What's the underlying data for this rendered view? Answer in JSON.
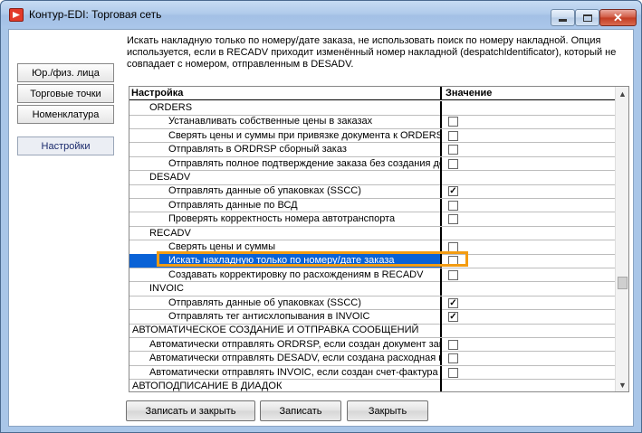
{
  "window": {
    "title": "Контур-EDI: Торговая сеть",
    "close_glyph": "✕"
  },
  "description": "Искать накладную только по номеру/дате заказа, не использовать поиск по номеру накладной. Опция используется, если в RECADV приходит изменённый номер накладной (despatchIdentificator), который не совпадает с номером, отправленным в DESADV.",
  "sidebar": {
    "items": [
      {
        "label": "Юр./физ. лица"
      },
      {
        "label": "Торговые точки"
      },
      {
        "label": "Номенклатура"
      },
      {
        "label": "Настройки"
      }
    ]
  },
  "grid": {
    "headers": {
      "setting": "Настройка",
      "value": "Значение"
    },
    "rows": [
      {
        "label": "ORDERS",
        "level": "lvl1",
        "checkbox": false
      },
      {
        "label": "Устанавливать собственные цены в заказах",
        "level": "lvl2",
        "checkbox": true,
        "checked": false
      },
      {
        "label": "Сверять цены и суммы при привязке документа к ORDERS",
        "level": "lvl2",
        "checkbox": true,
        "checked": false
      },
      {
        "label": "Отправлять в ORDRSP сборный заказ",
        "level": "lvl2",
        "checkbox": true,
        "checked": false
      },
      {
        "label": "Отправлять полное подтверждение заказа без создания документа",
        "level": "lvl2",
        "checkbox": true,
        "checked": false
      },
      {
        "label": "DESADV",
        "level": "lvl1",
        "checkbox": false
      },
      {
        "label": "Отправлять данные об упаковках (SSCC)",
        "level": "lvl2",
        "checkbox": true,
        "checked": true
      },
      {
        "label": "Отправлять данные по ВСД",
        "level": "lvl2",
        "checkbox": true,
        "checked": false
      },
      {
        "label": "Проверять корректность номера автотранспорта",
        "level": "lvl2",
        "checkbox": true,
        "checked": false
      },
      {
        "label": "RECADV",
        "level": "lvl1",
        "checkbox": false
      },
      {
        "label": "Сверять цены и суммы",
        "level": "lvl2",
        "checkbox": true,
        "checked": false
      },
      {
        "label": "Искать накладную только по номеру/дате заказа",
        "level": "lvl2",
        "checkbox": true,
        "checked": false,
        "selected": true
      },
      {
        "label": "Создавать корректировку по расхождениям в RECADV",
        "level": "lvl2",
        "checkbox": true,
        "checked": false
      },
      {
        "label": "INVOIC",
        "level": "lvl1",
        "checkbox": false
      },
      {
        "label": "Отправлять данные об упаковках (SSCC)",
        "level": "lvl2",
        "checkbox": true,
        "checked": true
      },
      {
        "label": "Отправлять тег антисхлопывания в INVOIC",
        "level": "lvl2",
        "checkbox": true,
        "checked": true
      },
      {
        "label": "АВТОМАТИЧЕСКОЕ СОЗДАНИЕ И ОТПРАВКА СООБЩЕНИЙ",
        "level": "lvl0",
        "checkbox": false
      },
      {
        "label": "Автоматически отправлять ORDRSP, если создан документ заказа",
        "level": "lvl1",
        "checkbox": true,
        "checked": false
      },
      {
        "label": "Автоматически отправлять DESADV, если создана расходная накладная",
        "level": "lvl1",
        "checkbox": true,
        "checked": false
      },
      {
        "label": "Автоматически отправлять INVOIC, если создан счет-фактура",
        "level": "lvl1",
        "checkbox": true,
        "checked": false
      },
      {
        "label": "АВТОПОДПИСАНИЕ В ДИАДОК",
        "level": "lvl0",
        "checkbox": false
      }
    ]
  },
  "buttons": {
    "save_close": "Записать и закрыть",
    "save": "Записать",
    "close": "Закрыть"
  },
  "scrollbar": {
    "up_glyph": "▲",
    "down_glyph": "▼"
  },
  "check_glyph": "✓"
}
